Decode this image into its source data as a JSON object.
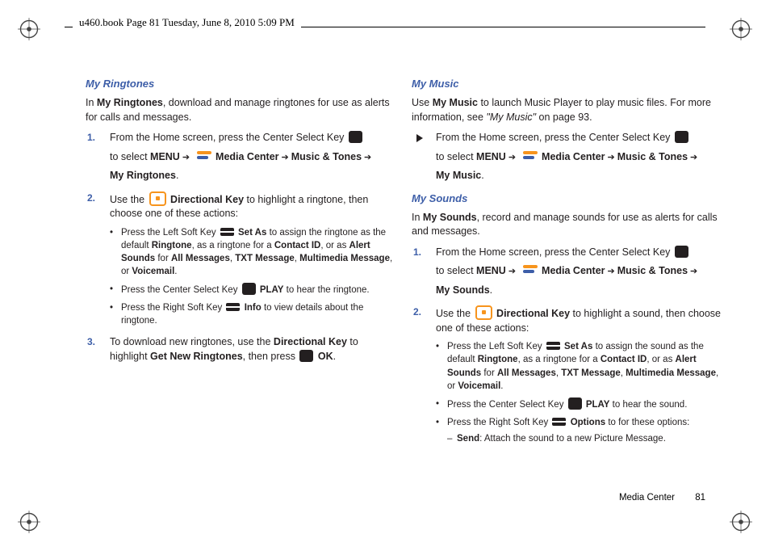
{
  "header": "u460.book  Page 81  Tuesday, June 8, 2010  5:09 PM",
  "footer": {
    "section": "Media Center",
    "page": "81"
  },
  "left": {
    "h_ringtones": "My Ringtones",
    "ringtones_intro_pre": "In ",
    "ringtones_intro_b": "My Ringtones",
    "ringtones_intro_post": ", download and manage ringtones for use as alerts for calls and messages.",
    "step1": {
      "num": "1.",
      "pre": "From the Home screen, press the Center Select Key ",
      "pre2": " to select ",
      "menu": "MENU",
      "media": "Media Center",
      "music": "Music & Tones",
      "tgt": "My Ringtones",
      "end": "."
    },
    "step2": {
      "num": "2.",
      "pre": "Use the ",
      "dirkey": "Directional Key",
      "post": " to highlight a ringtone, then choose one of these actions:",
      "b1_pre": "Press the Left Soft Key ",
      "b1_setas": "Set As",
      "b1_mid": " to assign the ringtone as the default ",
      "b1_ring": "Ringtone",
      "b1_mid2": ", as a ringtone for a ",
      "b1_cid": "Contact ID",
      "b1_mid3": ", or as ",
      "b1_alert": "Alert Sounds",
      "b1_for": " for ",
      "b1_am": "All Messages",
      "b1_sep": ", ",
      "b1_txt": "TXT Message",
      "b1_mm": "Multimedia Message",
      "b1_or": ", or ",
      "b1_vm": "Voicemail",
      "b1_end": ".",
      "b2_pre": "Press the Center Select Key ",
      "b2_play": "PLAY",
      "b2_post": " to hear the ringtone.",
      "b3_pre": "Press the Right Soft Key ",
      "b3_info": "Info",
      "b3_post": " to view details about the ringtone."
    },
    "step3": {
      "num": "3.",
      "pre": "To download new ringtones, use the ",
      "dirkey": "Directional Key",
      "mid": " to highlight ",
      "getnew": "Get New Ringtones",
      "mid2": ", then press ",
      "ok": "OK",
      "end": "."
    }
  },
  "right": {
    "h_music": "My Music",
    "music_intro_pre": "Use ",
    "music_intro_b": "My Music",
    "music_intro_mid": " to launch Music Player to play music files. For more information, see ",
    "music_ref": "\"My Music\"",
    "music_intro_post": " on page 93.",
    "mstep": {
      "pre": "From the Home screen, press the Center Select Key ",
      "pre2": " to select ",
      "menu": "MENU",
      "media": "Media Center",
      "music": "Music & Tones",
      "tgt": "My Music",
      "end": "."
    },
    "h_sounds": "My Sounds",
    "sounds_intro_pre": "In ",
    "sounds_intro_b": "My Sounds",
    "sounds_intro_post": ", record and manage sounds for use as alerts for calls and messages.",
    "sstep1": {
      "num": "1.",
      "pre": "From the Home screen, press the Center Select Key ",
      "pre2": " to select ",
      "menu": "MENU",
      "media": "Media Center",
      "music": "Music & Tones",
      "tgt": "My Sounds",
      "end": "."
    },
    "sstep2": {
      "num": "2.",
      "pre": "Use the ",
      "dirkey": "Directional Key",
      "post": " to highlight a sound, then choose one of these actions:",
      "b1_pre": "Press the Left Soft Key ",
      "b1_setas": "Set As",
      "b1_mid": " to assign the sound as the default ",
      "b1_ring": "Ringtone",
      "b1_mid2": ", as a ringtone for a ",
      "b1_cid": "Contact ID",
      "b1_mid3": ", or as ",
      "b1_alert": "Alert Sounds",
      "b1_for": " for ",
      "b1_am": "All Messages",
      "b1_sep": ", ",
      "b1_txt": "TXT Message",
      "b1_mm": "Multimedia Message",
      "b1_or": ", or ",
      "b1_vm": "Voicemail",
      "b1_end": ".",
      "b2_pre": "Press the Center Select Key ",
      "b2_play": "PLAY",
      "b2_post": " to hear the sound.",
      "b3_pre": "Press the Right Soft Key ",
      "b3_opt": "Options",
      "b3_post": " to for these options:",
      "s1_send": "Send",
      "s1_post": ": Attach the sound to a new Picture Message."
    }
  },
  "glyphs": {
    "arrow": "➔"
  }
}
